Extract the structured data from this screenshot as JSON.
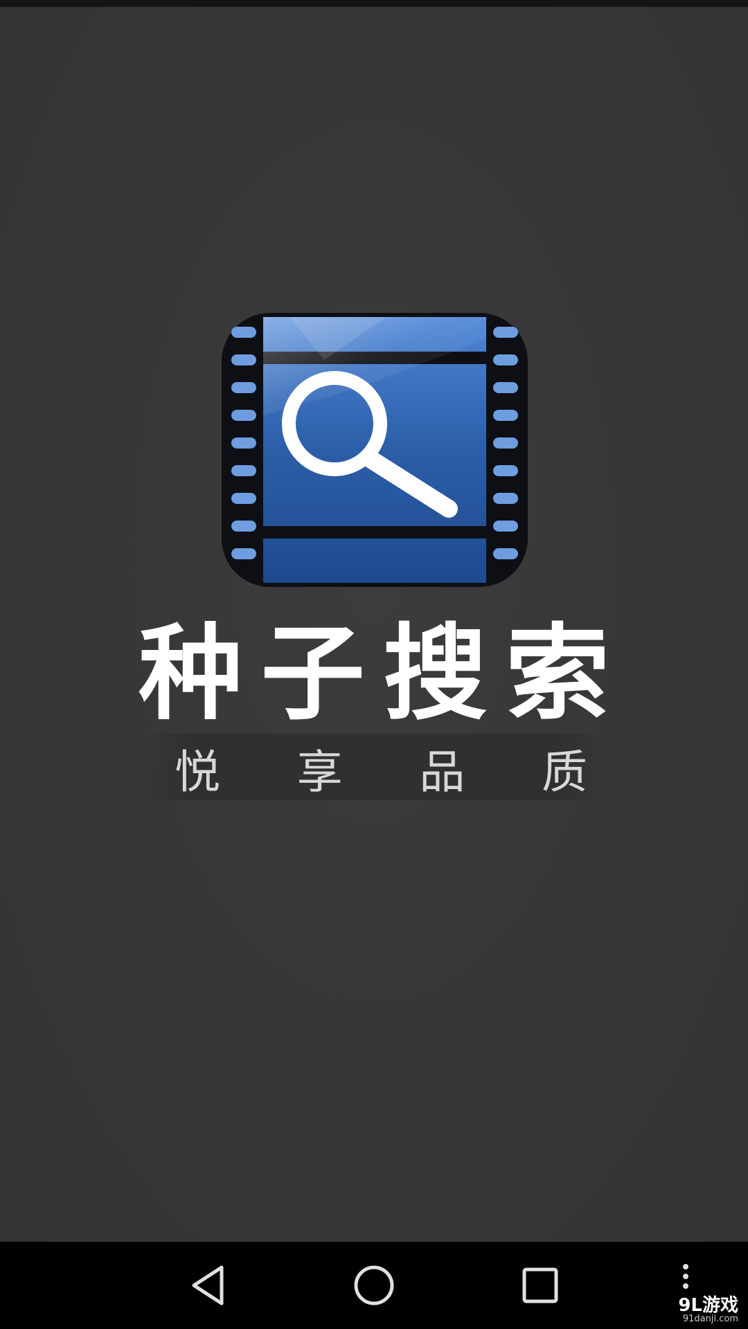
{
  "app": {
    "title_chars": [
      "种",
      "子",
      "搜",
      "索"
    ],
    "slogan_chars": [
      "悦",
      "享",
      "品",
      "质"
    ]
  },
  "icon": {
    "name": "film-search-icon",
    "colors": {
      "frame": "#0d0f14",
      "film_blue": "#2c5ea8",
      "film_blue_light": "#4e86d6",
      "sprocket": "#6e9de0",
      "lens": "#ffffff"
    }
  },
  "navigation": {
    "back_icon": "back-triangle-icon",
    "home_icon": "home-circle-icon",
    "recent_icon": "recent-square-icon",
    "menu_icon": "overflow-dots-icon"
  },
  "watermark": {
    "brand": "9L游戏",
    "url": "91danji.com"
  },
  "colors": {
    "background": "#3a3a3a",
    "nav_background": "#000000",
    "title_text": "#ffffff",
    "slogan_text": "#d8d8d8"
  }
}
